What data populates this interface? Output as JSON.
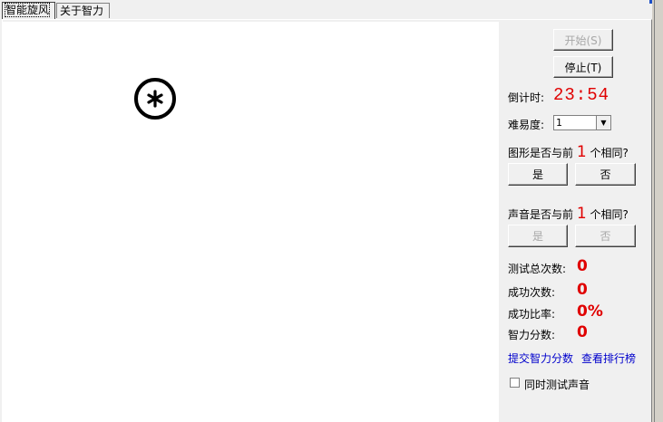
{
  "tabs": [
    {
      "label": "智能旋风"
    },
    {
      "label": "关于智力"
    }
  ],
  "canvas": {
    "symbol": "✱"
  },
  "controls": {
    "start_label": "开始(S)",
    "stop_label": "停止(T)",
    "countdown_label": "倒计时:",
    "countdown_value": "23:54",
    "difficulty_label": "难易度:",
    "difficulty_value": "1",
    "shape_question_prefix": "图形是否与前",
    "shape_question_n": "1",
    "shape_question_suffix": "个相同?",
    "shape_yes": "是",
    "shape_no": "否",
    "sound_question_prefix": "声音是否与前",
    "sound_question_n": "1",
    "sound_question_suffix": "个相同?",
    "sound_yes": "是",
    "sound_no": "否"
  },
  "stats": {
    "total_label": "测试总次数:",
    "total_value": "0",
    "success_label": "成功次数:",
    "success_value": "0",
    "rate_label": "成功比率:",
    "rate_value": "0%",
    "score_label": "智力分数:",
    "score_value": "0"
  },
  "links": {
    "submit": "提交智力分数",
    "ranking": "查看排行榜"
  },
  "options": {
    "sound_test_label": "同时测试声音",
    "sound_test_checked": false
  },
  "colors": {
    "value_red": "#e00000",
    "link_blue": "#0000cc"
  }
}
